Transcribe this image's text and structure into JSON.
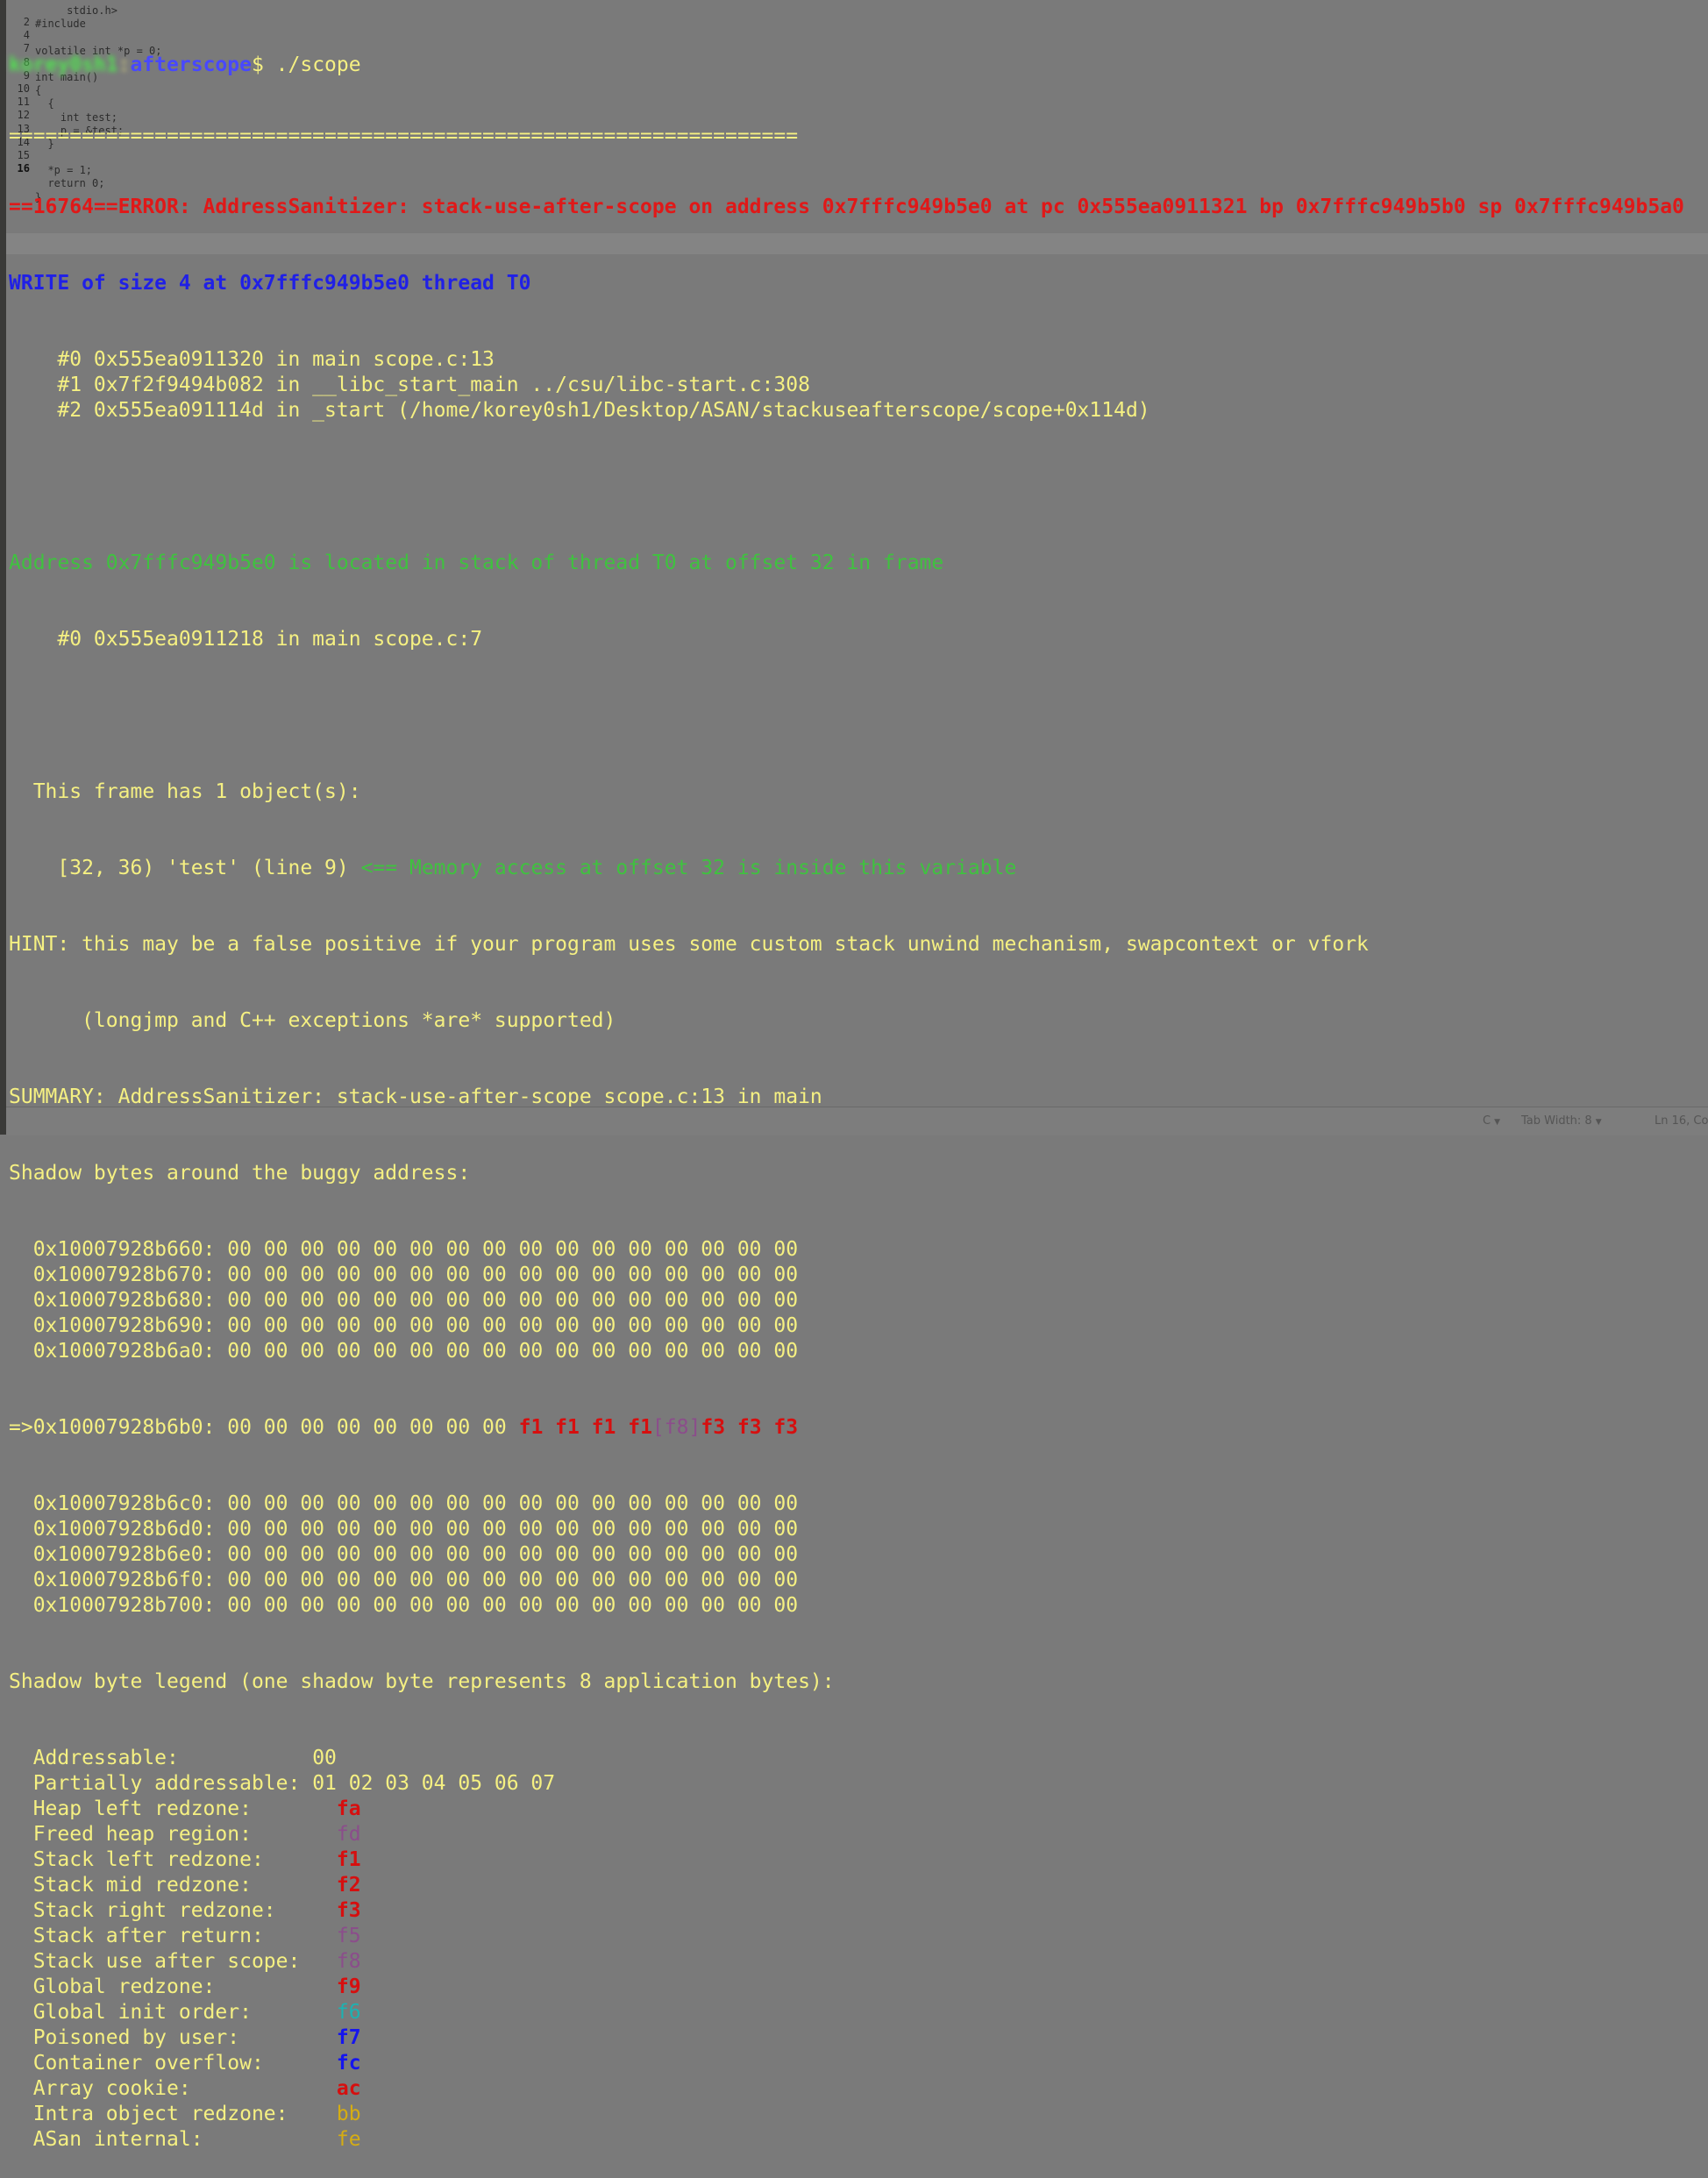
{
  "editor_underlay": {
    "gutter": [
      "2",
      "",
      "4",
      "",
      "",
      "7",
      "8",
      "9",
      "10",
      "11",
      "12",
      "13",
      "14",
      "15",
      "16"
    ],
    "code": [
      "     stdio.h>",
      "#include",
      "",
      "volatile int *p = 0;",
      "",
      "int main()",
      "{",
      "  {",
      "    int test;",
      "    p = &test;",
      "  }",
      "",
      "  *p = 1;",
      "  return 0;",
      "}"
    ]
  },
  "terminal": {
    "prompt": {
      "user": "korey0sh1",
      "path": "afterscope",
      "command": "$ ./scope"
    },
    "separator": "=================================================================",
    "error_line": "==16764==ERROR: AddressSanitizer: stack-use-after-scope on address 0x7fffc949b5e0 at pc 0x555ea0911321 bp 0x7fffc949b5b0 sp 0x7fffc949b5a0",
    "write_line": "WRITE of size 4 at 0x7fffc949b5e0 thread T0",
    "stack_frames": [
      "    #0 0x555ea0911320 in main scope.c:13",
      "    #1 0x7f2f9494b082 in __libc_start_main ../csu/libc-start.c:308",
      "    #2 0x555ea091114d in _start (/home/korey0sh1/Desktop/ASAN/stackuseafterscope/scope+0x114d)"
    ],
    "address_line": "Address 0x7fffc949b5e0 is located in stack of thread T0 at offset 32 in frame",
    "frame_line": "    #0 0x555ea0911218 in main scope.c:7",
    "objects_header": "  This frame has 1 object(s):",
    "object_line": "    [32, 36) 'test' (line 9) ",
    "object_hint": "<== Memory access at offset 32 is inside this variable",
    "hint_line": "HINT: this may be a false positive if your program uses some custom stack unwind mechanism, swapcontext or vfork",
    "hint_line2": "      (longjmp and C++ exceptions *are* supported)",
    "summary_line": "SUMMARY: AddressSanitizer: stack-use-after-scope scope.c:13 in main",
    "shadow_header": "Shadow bytes around the buggy address:",
    "shadow_rows_before": [
      "  0x10007928b660: 00 00 00 00 00 00 00 00 00 00 00 00 00 00 00 00",
      "  0x10007928b670: 00 00 00 00 00 00 00 00 00 00 00 00 00 00 00 00",
      "  0x10007928b680: 00 00 00 00 00 00 00 00 00 00 00 00 00 00 00 00",
      "  0x10007928b690: 00 00 00 00 00 00 00 00 00 00 00 00 00 00 00 00",
      "  0x10007928b6a0: 00 00 00 00 00 00 00 00 00 00 00 00 00 00 00 00"
    ],
    "buggy_row": {
      "prefix": "=>0x10007928b6b0: 00 00 00 00 00 00 00 00 ",
      "redzone": "f1 f1 f1 f1",
      "open": "[",
      "hit": "f8",
      "close": "]",
      "after": "f3 f3 f3"
    },
    "shadow_rows_after": [
      "  0x10007928b6c0: 00 00 00 00 00 00 00 00 00 00 00 00 00 00 00 00",
      "  0x10007928b6d0: 00 00 00 00 00 00 00 00 00 00 00 00 00 00 00 00",
      "  0x10007928b6e0: 00 00 00 00 00 00 00 00 00 00 00 00 00 00 00 00",
      "  0x10007928b6f0: 00 00 00 00 00 00 00 00 00 00 00 00 00 00 00 00",
      "  0x10007928b700: 00 00 00 00 00 00 00 00 00 00 00 00 00 00 00 00"
    ],
    "legend_header": "Shadow byte legend (one shadow byte represents 8 application bytes):",
    "legend": [
      {
        "label": "  Addressable:           ",
        "value": "00",
        "color": "plain"
      },
      {
        "label": "  Partially addressable: ",
        "value": "01 02 03 04 05 06 07",
        "color": "plain"
      },
      {
        "label": "  Heap left redzone:       ",
        "value": "fa",
        "color": "red"
      },
      {
        "label": "  Freed heap region:       ",
        "value": "fd",
        "color": "purple"
      },
      {
        "label": "  Stack left redzone:      ",
        "value": "f1",
        "color": "red"
      },
      {
        "label": "  Stack mid redzone:       ",
        "value": "f2",
        "color": "red"
      },
      {
        "label": "  Stack right redzone:     ",
        "value": "f3",
        "color": "red"
      },
      {
        "label": "  Stack after return:      ",
        "value": "f5",
        "color": "purple"
      },
      {
        "label": "  Stack use after scope:   ",
        "value": "f8",
        "color": "purple"
      },
      {
        "label": "  Global redzone:          ",
        "value": "f9",
        "color": "red"
      },
      {
        "label": "  Global init order:       ",
        "value": "f6",
        "color": "cyan"
      },
      {
        "label": "  Poisoned by user:        ",
        "value": "f7",
        "color": "blue"
      },
      {
        "label": "  Container overflow:      ",
        "value": "fc",
        "color": "blue"
      },
      {
        "label": "  Array cookie:            ",
        "value": "ac",
        "color": "red"
      },
      {
        "label": "  Intra object redzone:    ",
        "value": "bb",
        "color": "orange"
      },
      {
        "label": "  ASan internal:           ",
        "value": "fe",
        "color": "orange"
      }
    ]
  },
  "status_bar": {
    "language": "C",
    "tab_width": "Tab Width: 8",
    "position": "Ln 16, Co"
  },
  "colors": {
    "background": "#7a7a7a",
    "text": "#f5f082",
    "error_red": "#e01818",
    "write_blue": "#2020e6",
    "address_green": "#3fc23f",
    "prompt_green": "#4eea4e",
    "prompt_path_blue": "#4848ff"
  }
}
